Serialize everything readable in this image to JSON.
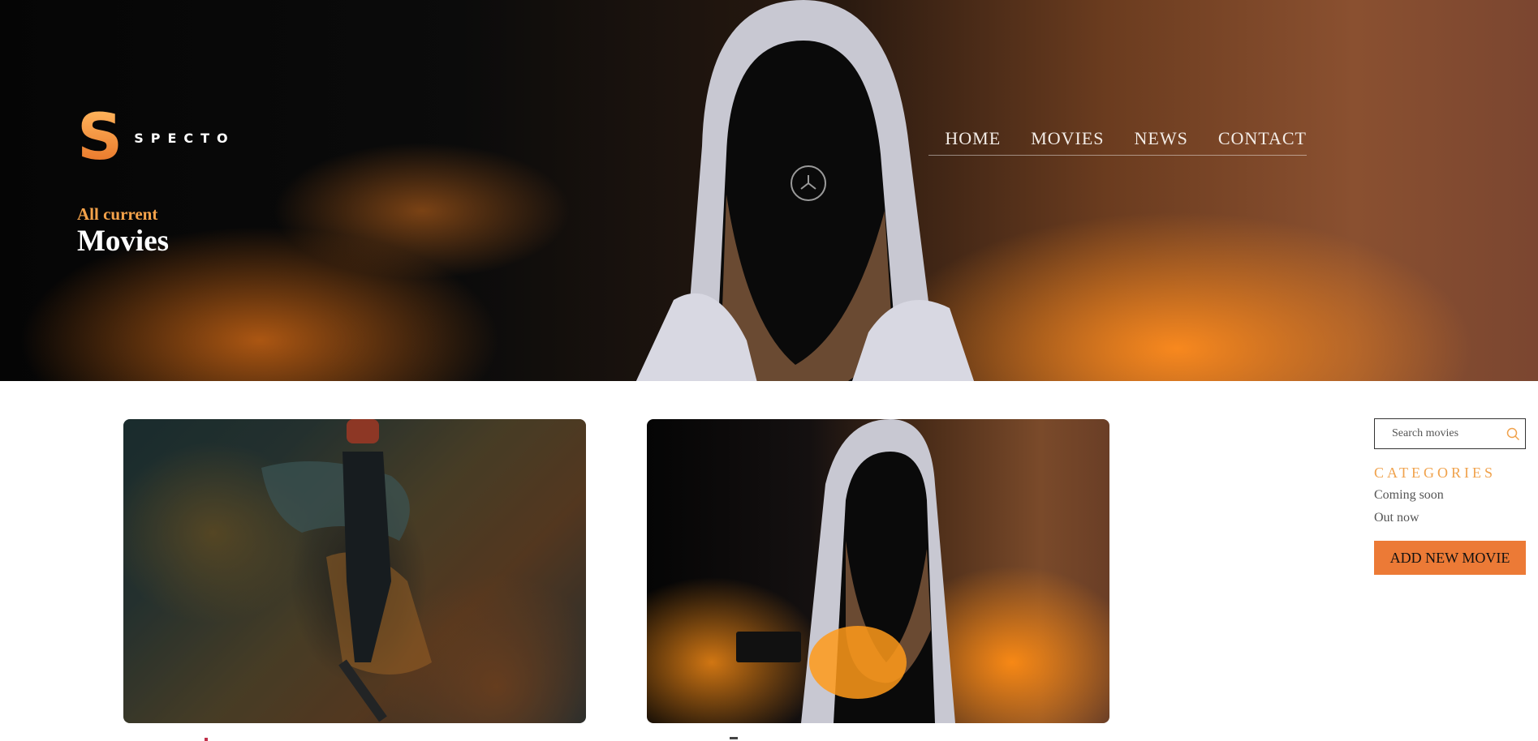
{
  "brand": {
    "logo_letter": "S",
    "name": "SPECTO",
    "accent": "#f4953c"
  },
  "nav": {
    "items": [
      "HOME",
      "MOVIES",
      "NEWS",
      "CONTACT"
    ]
  },
  "hero": {
    "subtitle": "All current",
    "title": "Movies"
  },
  "cards": [
    {
      "image": "graffiti-skater-photo"
    },
    {
      "image": "hooded-person-orange-smoke-photo"
    }
  ],
  "sidebar": {
    "search_placeholder": "Search movies",
    "categories_heading": "CATEGORIES",
    "categories": [
      "Coming soon",
      "Out now"
    ],
    "add_button": "ADD NEW MOVIE",
    "button_color": "#ec7a36",
    "heading_color": "#f0a24c"
  },
  "icons": {
    "search": "search-icon"
  }
}
